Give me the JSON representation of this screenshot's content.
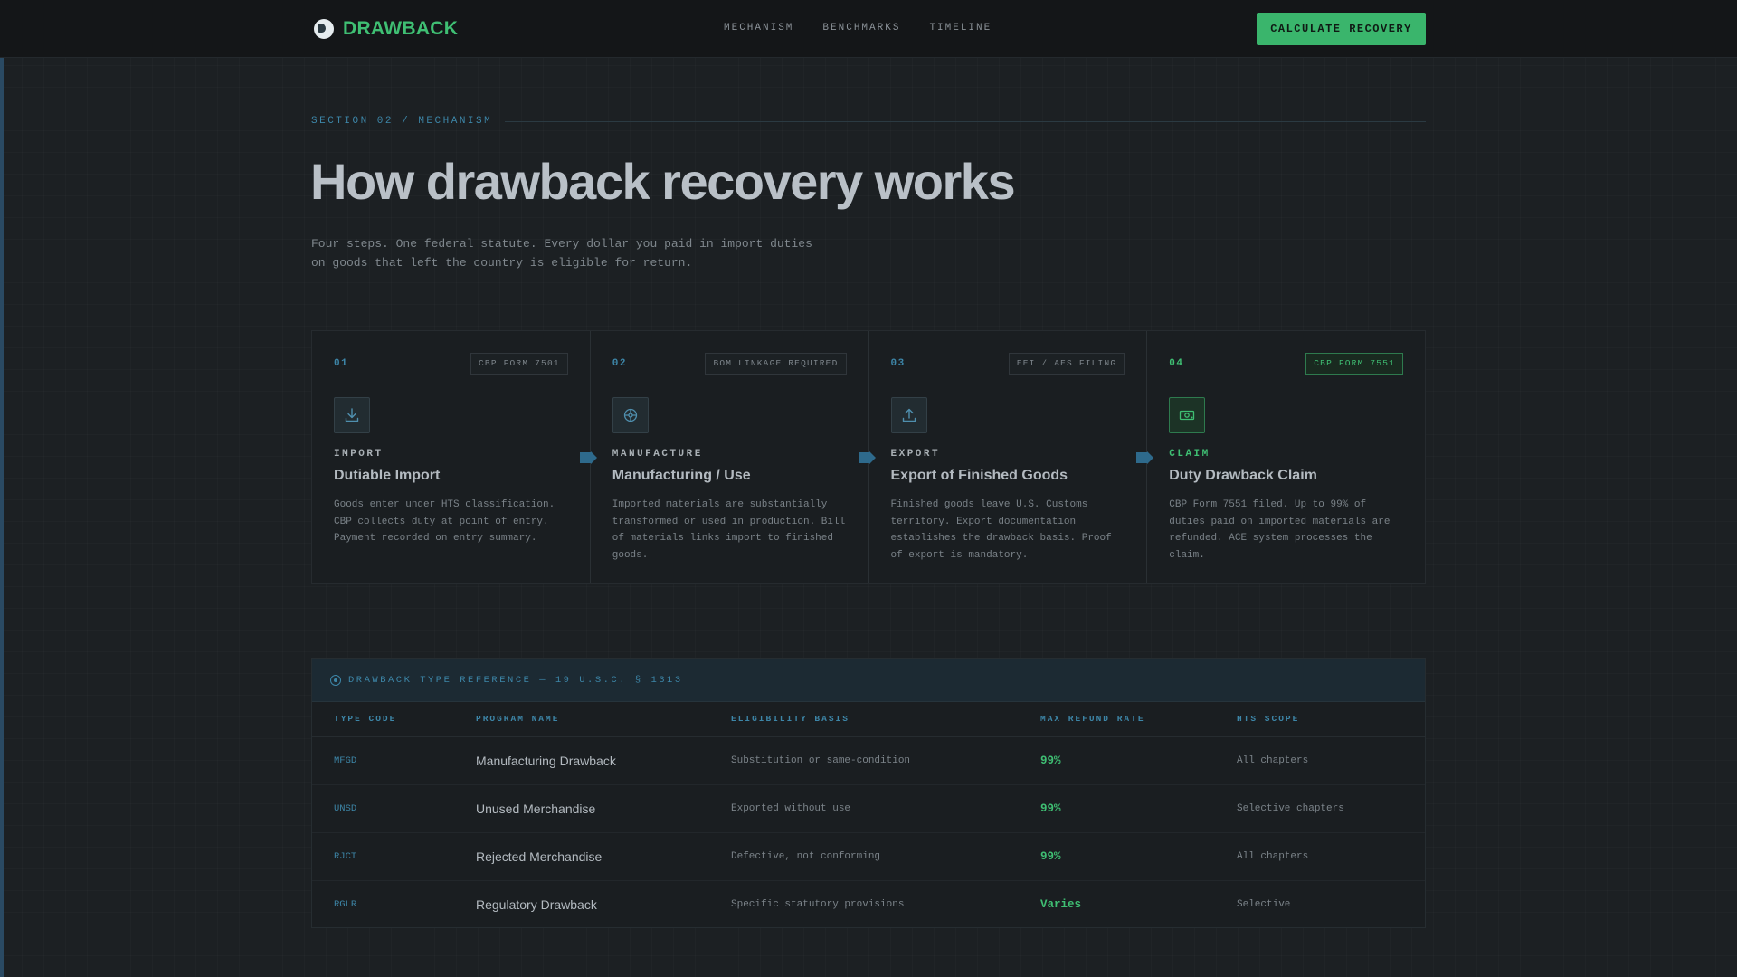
{
  "brand": {
    "name": "DRAWBACK",
    "logo_icon": "globe-icon"
  },
  "nav": {
    "items": [
      {
        "label": "MECHANISM"
      },
      {
        "label": "BENCHMARKS"
      },
      {
        "label": "TIMELINE"
      }
    ],
    "cta_label": "CALCULATE RECOVERY"
  },
  "section": {
    "label": "SECTION 02 / MECHANISM",
    "title": "How drawback recovery works",
    "subtitle_line1": "Four steps. One federal statute. Every dollar you paid in import duties",
    "subtitle_line2": "on goods that left the country is eligible for return."
  },
  "steps": [
    {
      "num": "01",
      "badge": "CBP FORM 7501",
      "icon": "download-icon",
      "kicker": "IMPORT",
      "title": "Dutiable Import",
      "desc": "Goods enter under HTS classification. CBP collects duty at point of entry. Payment recorded on entry summary."
    },
    {
      "num": "02",
      "badge": "BOM LINKAGE REQUIRED",
      "icon": "gear-icon",
      "kicker": "MANUFACTURE",
      "title": "Manufacturing / Use",
      "desc": "Imported materials are substantially transformed or used in production. Bill of materials links import to finished goods."
    },
    {
      "num": "03",
      "badge": "EEI / AES FILING",
      "icon": "upload-icon",
      "kicker": "EXPORT",
      "title": "Export of Finished Goods",
      "desc": "Finished goods leave U.S. Customs territory. Export documentation establishes the drawback basis. Proof of export is mandatory."
    },
    {
      "num": "04",
      "badge": "CBP FORM 7551",
      "icon": "money-icon",
      "kicker": "CLAIM",
      "title": "Duty Drawback Claim",
      "desc": "CBP Form 7551 filed. Up to 99% of duties paid on imported materials are refunded. ACE system processes the claim."
    }
  ],
  "reference": {
    "title": "DRAWBACK TYPE REFERENCE — 19 U.S.C. § 1313",
    "columns": [
      "TYPE CODE",
      "PROGRAM NAME",
      "ELIGIBILITY BASIS",
      "MAX REFUND RATE",
      "HTS SCOPE"
    ],
    "rows": [
      {
        "code": "MFGD",
        "program": "Manufacturing Drawback",
        "basis": "Substitution or same-condition",
        "rate": "99%",
        "scope": "All chapters"
      },
      {
        "code": "UNSD",
        "program": "Unused Merchandise",
        "basis": "Exported without use",
        "rate": "99%",
        "scope": "Selective chapters"
      },
      {
        "code": "RJCT",
        "program": "Rejected Merchandise",
        "basis": "Defective, not conforming",
        "rate": "99%",
        "scope": "All chapters"
      },
      {
        "code": "RGLR",
        "program": "Regulatory Drawback",
        "basis": "Specific statutory provisions",
        "rate": "Varies",
        "scope": "Selective"
      }
    ]
  },
  "colors": {
    "accent_green": "#3fbf73",
    "accent_blue": "#3d86a8",
    "background": "#1c2023"
  }
}
